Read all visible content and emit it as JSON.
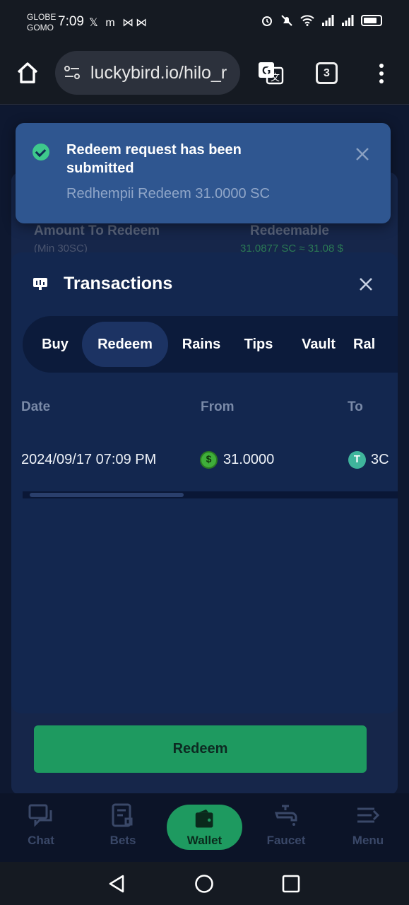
{
  "status_bar": {
    "carrier_line1": "GLOBE",
    "carrier_line2": "GOMO",
    "time": "7:09",
    "app_icons": "𝕏 m ⋈⋈"
  },
  "browser": {
    "url": "luckybird.io/hilo_r",
    "tab_count": "3"
  },
  "background_page": {
    "amount_label": "Amount To Redeem",
    "amount_sub": "(Min 30SC)",
    "redeemable_label": "Redeemable",
    "redeemable_value": "31.0877 SC ≈ 31.08 $"
  },
  "toast": {
    "title": "Redeem request has been submitted",
    "message": "Redhempii Redeem 31.0000 SC",
    "accent": "#3ec98c"
  },
  "modal": {
    "title": "Transactions",
    "tabs": [
      "Buy",
      "Redeem",
      "Rains",
      "Tips",
      "Vault",
      "Ral"
    ],
    "active_tab": "Redeem",
    "columns": [
      "Date",
      "From",
      "To"
    ],
    "rows": [
      {
        "date": "2024/09/17 07:09 PM",
        "from_amount": "31.0000",
        "from_icon": "sweeps-coin-icon",
        "to_amount": "3C",
        "to_icon": "tether-icon"
      }
    ]
  },
  "redeem_button": {
    "label": "Redeem"
  },
  "site_nav": {
    "items": [
      {
        "label": "Chat",
        "icon": "chat-icon"
      },
      {
        "label": "Bets",
        "icon": "bets-icon"
      },
      {
        "label": "Wallet",
        "icon": "wallet-icon"
      },
      {
        "label": "Faucet",
        "icon": "faucet-icon"
      },
      {
        "label": "Menu",
        "icon": "menu-icon"
      }
    ],
    "active": "Wallet"
  },
  "colors": {
    "brand_green": "#1e9a60",
    "toast_bg": "#2f5690",
    "modal_bg": "#13274f"
  }
}
